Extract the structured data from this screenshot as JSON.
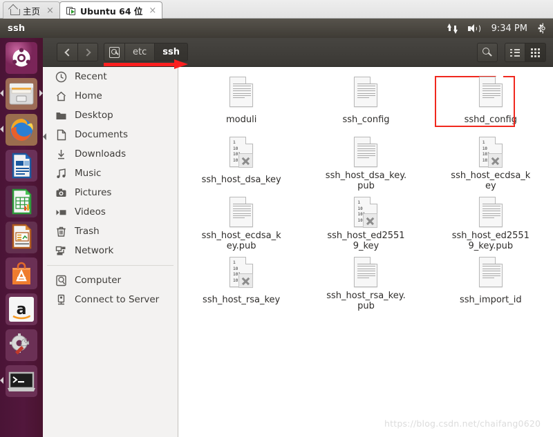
{
  "vmware": {
    "tabs": [
      {
        "label": "主页",
        "icon": "home-icon",
        "active": false,
        "close": "×"
      },
      {
        "label": "Ubuntu 64 位",
        "icon": "virtual-machine-icon",
        "active": true,
        "close": "×"
      }
    ]
  },
  "top_panel": {
    "app_title": "ssh",
    "tray": {
      "network_icon": "network-up-down-icon",
      "volume_icon": "volume-icon",
      "clock": "9:34 PM",
      "settings_icon": "gear-icon"
    }
  },
  "launcher": {
    "items": [
      {
        "name": "ubuntu-dash",
        "label": "Ubuntu Dash"
      },
      {
        "name": "files",
        "label": "Files"
      },
      {
        "name": "firefox",
        "label": "Firefox"
      },
      {
        "name": "libreoffice-writer",
        "label": "LibreOffice Writer"
      },
      {
        "name": "libreoffice-calc",
        "label": "LibreOffice Calc"
      },
      {
        "name": "libreoffice-impress",
        "label": "LibreOffice Impress"
      },
      {
        "name": "ubuntu-software",
        "label": "Ubuntu Software"
      },
      {
        "name": "amazon",
        "label": "Amazon"
      },
      {
        "name": "system-settings",
        "label": "System Settings"
      },
      {
        "name": "terminal",
        "label": "Terminal"
      }
    ]
  },
  "file_manager": {
    "nav": {
      "back": "‹",
      "forward": "›"
    },
    "breadcrumbs": [
      {
        "label": "",
        "icon": "disk-icon",
        "current": false
      },
      {
        "label": "etc",
        "current": false
      },
      {
        "label": "ssh",
        "current": true
      }
    ],
    "toolbar": {
      "search_icon": "search-icon",
      "list_view_icon": "list-view-icon",
      "grid_view_icon": "grid-view-icon",
      "active_view": "grid"
    },
    "places": [
      {
        "label": "Recent",
        "icon": "clock-icon"
      },
      {
        "label": "Home",
        "icon": "home-icon"
      },
      {
        "label": "Desktop",
        "icon": "folder-icon"
      },
      {
        "label": "Documents",
        "icon": "document-icon"
      },
      {
        "label": "Downloads",
        "icon": "download-icon"
      },
      {
        "label": "Music",
        "icon": "music-icon"
      },
      {
        "label": "Pictures",
        "icon": "camera-icon"
      },
      {
        "label": "Videos",
        "icon": "video-icon"
      },
      {
        "label": "Trash",
        "icon": "trash-icon"
      },
      {
        "label": "Network",
        "icon": "network-icon"
      }
    ],
    "places_bottom": [
      {
        "label": "Computer",
        "icon": "disk-icon"
      },
      {
        "label": "Connect to Server",
        "icon": "server-icon"
      }
    ],
    "files": [
      {
        "name": "moduli",
        "type": "text",
        "selected": false
      },
      {
        "name": "ssh_config",
        "type": "text",
        "selected": false
      },
      {
        "name": "sshd_config",
        "type": "text",
        "selected": true
      },
      {
        "name": "ssh_host_dsa_key",
        "type": "binary-locked",
        "selected": false
      },
      {
        "name": "ssh_host_dsa_key.pub",
        "type": "text",
        "selected": false
      },
      {
        "name": "ssh_host_ecdsa_key",
        "type": "binary-locked",
        "selected": false
      },
      {
        "name": "ssh_host_ecdsa_key.pub",
        "type": "text",
        "selected": false
      },
      {
        "name": "ssh_host_ed25519_key",
        "type": "binary-locked",
        "selected": false
      },
      {
        "name": "ssh_host_ed25519_key.pub",
        "type": "text",
        "selected": false
      },
      {
        "name": "ssh_host_rsa_key",
        "type": "binary-locked",
        "selected": false
      },
      {
        "name": "ssh_host_rsa_key.pub",
        "type": "text",
        "selected": false
      },
      {
        "name": "ssh_import_id",
        "type": "text",
        "selected": false
      }
    ],
    "binary_icon_lines": [
      "1",
      "10",
      "101",
      "1010"
    ]
  },
  "annotations": {
    "arrow_color": "#fb1f1f",
    "highlight_color": "#f0281e",
    "highlight_target": "sshd_config",
    "watermark": "https://blog.csdn.net/chaifang0620"
  }
}
